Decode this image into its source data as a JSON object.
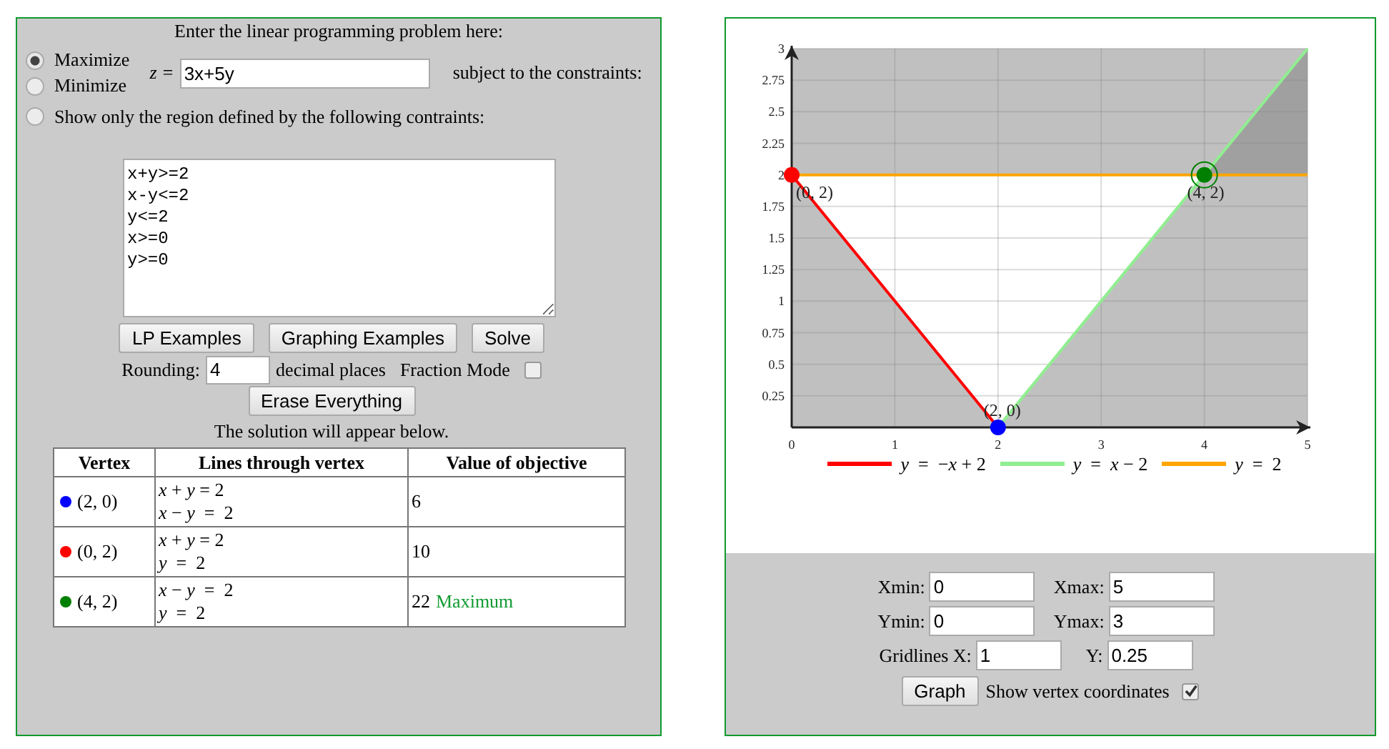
{
  "problem": {
    "title": "Enter the linear programming problem here:",
    "modes": [
      {
        "label": "Maximize",
        "selected": true
      },
      {
        "label": "Minimize",
        "selected": false
      },
      {
        "label": "Show only the region defined by the following contraints:",
        "selected": false
      }
    ],
    "objective_label": "z =",
    "objective": "3x+5y",
    "subject_label": "subject to the constraints:",
    "constraints": "x+y>=2\nx-y<=2\ny<=2\nx>=0\ny>=0",
    "buttons": [
      "LP Examples",
      "Graphing Examples",
      "Solve"
    ],
    "rounding_label": "Rounding:",
    "rounding": "4",
    "decimal_label": "decimal places",
    "fraction_label": "Fraction Mode",
    "fraction_mode": false,
    "erase_button": "Erase Everything",
    "solution_note": "The solution will appear below."
  },
  "solution_table": {
    "columns": [
      "Vertex",
      "Lines through vertex",
      "Value of objective"
    ],
    "rows": [
      {
        "color": "#0000ff",
        "vertex": "(2, 0)",
        "lines": [
          "*x* + *y* = 2",
          "*x* − *y*  =  2"
        ],
        "value": "6"
      },
      {
        "color": "#ff0000",
        "vertex": "(0, 2)",
        "lines": [
          "*x* + *y* = 2",
          "*y*  =  2"
        ],
        "value": "10"
      },
      {
        "color": "#008000",
        "vertex": "(4, 2)",
        "lines": [
          "*x* − *y*  =  2",
          "*y*  =  2"
        ],
        "value": "22",
        "note": "Maximum"
      }
    ]
  },
  "graph": {
    "chart_data": {
      "type": "line",
      "x": [
        0,
        1,
        2,
        3,
        4,
        5
      ],
      "xlim": [
        0,
        5
      ],
      "ylim": [
        0,
        3
      ],
      "xticks": [
        0,
        1,
        2,
        3,
        4,
        5
      ],
      "yticks": [
        0.25,
        0.5,
        0.75,
        1,
        1.25,
        1.5,
        1.75,
        2,
        2.25,
        2.5,
        2.75,
        3
      ],
      "series": [
        {
          "name": "*y*  =  −*x* + 2",
          "color": "#ff0000",
          "values": [
            2,
            1,
            0,
            null,
            null,
            null
          ]
        },
        {
          "name": "*y*  =  *x* − 2",
          "color": "#90ee90",
          "values": [
            null,
            null,
            0,
            1,
            2,
            3
          ]
        },
        {
          "name": "*y*  =  2",
          "color": "#ffa500",
          "values": [
            2,
            2,
            2,
            2,
            2,
            2
          ]
        }
      ],
      "annotations": [
        {
          "text": "(0, 2)",
          "x": 0,
          "y": 2
        },
        {
          "text": "(2, 0)",
          "x": 2,
          "y": 0
        },
        {
          "text": "(4, 2)",
          "x": 4,
          "y": 2
        }
      ],
      "grid": true
    },
    "vertex_points": [
      {
        "color": "#ff0000"
      },
      {
        "color": "#0000ff"
      },
      {
        "color": "#008000"
      }
    ],
    "fields": [
      {
        "label": "Xmin:",
        "value": "0"
      },
      {
        "label": "Xmax:",
        "value": "5"
      },
      {
        "label": "Ymin:",
        "value": "0"
      },
      {
        "label": "Ymax:",
        "value": "3"
      },
      {
        "label": "Gridlines X:",
        "value": "1"
      },
      {
        "label": "Y:",
        "value": "0.25"
      }
    ],
    "graph_button": "Graph",
    "show_vertex_label": "Show vertex coordinates",
    "show_vertex": true
  }
}
